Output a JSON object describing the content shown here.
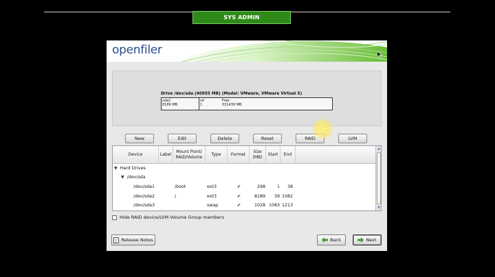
{
  "banner": {
    "title": "SYS ADMIN"
  },
  "installer": {
    "logo": "openfiler",
    "drive": {
      "title": "Drive /dev/sda (40955 MB) (Model: VMware, VMware Virtual S)",
      "segments": [
        {
          "name": "sda2",
          "size": "8189 MB"
        },
        {
          "name": "sd",
          "size": "1"
        },
        {
          "name": "Free",
          "size": "031439 MB"
        }
      ]
    },
    "actions": {
      "new": "New",
      "edit": "Edit",
      "delete": "Delete",
      "reset": "Reset",
      "raid": "RAID",
      "lvm": "LVM"
    },
    "table": {
      "headers": {
        "device": "Device",
        "label": "Label",
        "mount": "Mount Point/\nRAID/Volume",
        "type": "Type",
        "format": "Format",
        "size": "Size\n(MB)",
        "start": "Start",
        "end": "End"
      },
      "groups": {
        "hard_drives": "Hard Drives",
        "sda": "/dev/sda"
      },
      "rows": [
        {
          "device": "/dev/sda1",
          "mount": "/boot",
          "type": "ext3",
          "format": "✔",
          "size": "298",
          "start": "1",
          "end": "38"
        },
        {
          "device": "/dev/sda2",
          "mount": "/",
          "type": "ext3",
          "format": "✔",
          "size": "8189",
          "start": "39",
          "end": "1082"
        },
        {
          "device": "/dev/sda3",
          "mount": "",
          "type": "swap",
          "format": "✔",
          "size": "1028",
          "start": "1083",
          "end": "1213"
        }
      ]
    },
    "hide_raid_label": "Hide RAID device/LVM Volume Group members",
    "footer": {
      "release_notes": "Release Notes",
      "back": "Back",
      "next": "Next"
    }
  }
}
